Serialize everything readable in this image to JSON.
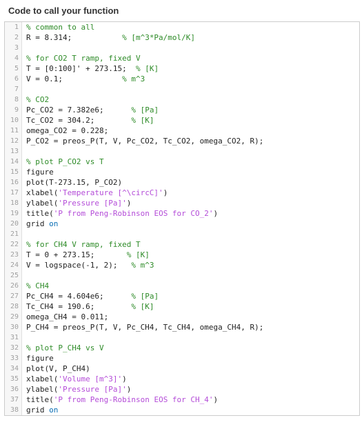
{
  "header": {
    "title": "Code to call your function"
  },
  "code": {
    "lines": [
      [
        {
          "cls": "tok-comment",
          "t": "% common to all"
        }
      ],
      [
        {
          "t": "R = 8.314;           "
        },
        {
          "cls": "tok-comment",
          "t": "% [m^3*Pa/mol/K]"
        }
      ],
      [
        {
          "t": ""
        }
      ],
      [
        {
          "cls": "tok-comment",
          "t": "% for CO2 T ramp, fixed V"
        }
      ],
      [
        {
          "t": "T = [0:100]' + 273.15;  "
        },
        {
          "cls": "tok-comment",
          "t": "% [K]"
        }
      ],
      [
        {
          "t": "V = 0.1;             "
        },
        {
          "cls": "tok-comment",
          "t": "% m^3"
        }
      ],
      [
        {
          "t": ""
        }
      ],
      [
        {
          "cls": "tok-comment",
          "t": "% CO2"
        }
      ],
      [
        {
          "t": "Pc_CO2 = 7.382e6;      "
        },
        {
          "cls": "tok-comment",
          "t": "% [Pa]"
        }
      ],
      [
        {
          "t": "Tc_CO2 = 304.2;        "
        },
        {
          "cls": "tok-comment",
          "t": "% [K]"
        }
      ],
      [
        {
          "t": "omega_CO2 = 0.228;"
        }
      ],
      [
        {
          "t": "P_CO2 = preos_P(T, V, Pc_CO2, Tc_CO2, omega_CO2, R);"
        }
      ],
      [
        {
          "t": ""
        }
      ],
      [
        {
          "cls": "tok-comment",
          "t": "% plot P_CO2 vs T"
        }
      ],
      [
        {
          "t": "figure"
        }
      ],
      [
        {
          "t": "plot(T-273.15, P_CO2)"
        }
      ],
      [
        {
          "t": "xlabel("
        },
        {
          "cls": "tok-string",
          "t": "'Temperature [^\\circC]'"
        },
        {
          "t": ")"
        }
      ],
      [
        {
          "t": "ylabel("
        },
        {
          "cls": "tok-string",
          "t": "'Pressure [Pa]'"
        },
        {
          "t": ")"
        }
      ],
      [
        {
          "t": "title("
        },
        {
          "cls": "tok-string",
          "t": "'P from Peng-Robinson EOS for CO_2'"
        },
        {
          "t": ")"
        }
      ],
      [
        {
          "t": "grid "
        },
        {
          "cls": "tok-keyword",
          "t": "on"
        }
      ],
      [
        {
          "t": ""
        }
      ],
      [
        {
          "cls": "tok-comment",
          "t": "% for CH4 V ramp, fixed T"
        }
      ],
      [
        {
          "t": "T = 0 + 273.15;       "
        },
        {
          "cls": "tok-comment",
          "t": "% [K]"
        }
      ],
      [
        {
          "t": "V = logspace(-1, 2);   "
        },
        {
          "cls": "tok-comment",
          "t": "% m^3"
        }
      ],
      [
        {
          "t": ""
        }
      ],
      [
        {
          "cls": "tok-comment",
          "t": "% CH4"
        }
      ],
      [
        {
          "t": "Pc_CH4 = 4.604e6;      "
        },
        {
          "cls": "tok-comment",
          "t": "% [Pa]"
        }
      ],
      [
        {
          "t": "Tc_CH4 = 190.6;        "
        },
        {
          "cls": "tok-comment",
          "t": "% [K]"
        }
      ],
      [
        {
          "t": "omega_CH4 = 0.011;"
        }
      ],
      [
        {
          "t": "P_CH4 = preos_P(T, V, Pc_CH4, Tc_CH4, omega_CH4, R);"
        }
      ],
      [
        {
          "t": ""
        }
      ],
      [
        {
          "cls": "tok-comment",
          "t": "% plot P_CH4 vs V"
        }
      ],
      [
        {
          "t": "figure"
        }
      ],
      [
        {
          "t": "plot(V, P_CH4)"
        }
      ],
      [
        {
          "t": "xlabel("
        },
        {
          "cls": "tok-string",
          "t": "'Volume [m^3]'"
        },
        {
          "t": ")"
        }
      ],
      [
        {
          "t": "ylabel("
        },
        {
          "cls": "tok-string",
          "t": "'Pressure [Pa]'"
        },
        {
          "t": ")"
        }
      ],
      [
        {
          "t": "title("
        },
        {
          "cls": "tok-string",
          "t": "'P from Peng-Robinson EOS for CH_4'"
        },
        {
          "t": ")"
        }
      ],
      [
        {
          "t": "grid "
        },
        {
          "cls": "tok-keyword",
          "t": "on"
        }
      ]
    ]
  }
}
